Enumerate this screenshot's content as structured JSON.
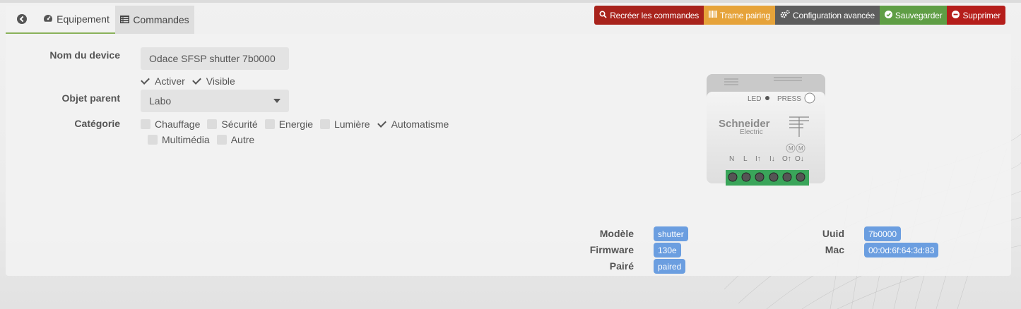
{
  "tabs": {
    "equipement": "Equipement",
    "commandes": "Commandes"
  },
  "actions": {
    "recreate": "Recréer les commandes",
    "trame": "Trame pairing",
    "config": "Configuration avancée",
    "save": "Sauvegarder",
    "delete": "Supprimer"
  },
  "form": {
    "name_label": "Nom du device",
    "name_value": "Odace SFSP  shutter 7b0000",
    "activate": "Activer",
    "visible": "Visible",
    "parent_label": "Objet parent",
    "parent_value": "Labo",
    "category_label": "Catégorie",
    "categories": [
      {
        "label": "Chauffage",
        "checked": false
      },
      {
        "label": "Sécurité",
        "checked": false
      },
      {
        "label": "Energie",
        "checked": false
      },
      {
        "label": "Lumière",
        "checked": false
      },
      {
        "label": "Automatisme",
        "checked": true
      },
      {
        "label": "Multimédia",
        "checked": false
      },
      {
        "label": "Autre",
        "checked": false
      }
    ]
  },
  "device_image": {
    "brand": "Schneider",
    "brand_sub": "Electric",
    "led": "LED",
    "press": "PRESS",
    "terminals": [
      "N",
      "L",
      "I↑",
      "I↓",
      "O↑",
      "O↓"
    ],
    "motor": "M"
  },
  "info": {
    "model_label": "Modèle",
    "model_value": "shutter",
    "firmware_label": "Firmware",
    "firmware_value": "130e",
    "paired_label": "Pairé",
    "paired_value": "paired",
    "uuid_label": "Uuid",
    "uuid_value": "7b0000",
    "mac_label": "Mac",
    "mac_value": "00:0d:6f:64:3d:83"
  },
  "colors": {
    "accent_green": "#8ab15a",
    "badge_blue": "#6b9ee0"
  }
}
